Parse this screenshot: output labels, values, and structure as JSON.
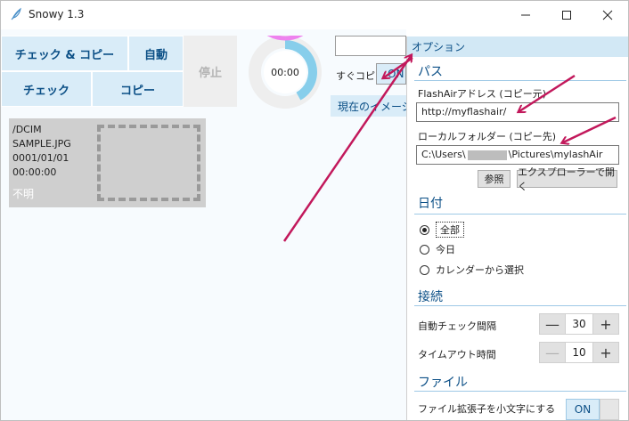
{
  "window": {
    "title": "Snowy 1.3",
    "icons": {
      "app": "feather-icon",
      "minimize": "minimize-icon",
      "maximize": "maximize-icon",
      "close": "close-icon"
    }
  },
  "toolbar": {
    "check_and_copy": "チェック & コピー",
    "auto": "自動",
    "check": "チェック",
    "copy": "コピー",
    "stop": "停止",
    "timer": "00:00",
    "timer_progress": 0.42,
    "auto_copy_label": "すぐコピー",
    "auto_copy_toggle": "ON",
    "current_image_tab": "現在のイメージ"
  },
  "file_card": {
    "path": "/DCIM",
    "filename": "SAMPLE.JPG",
    "date": "0001/01/01",
    "time": "00:00:00",
    "status": "不明"
  },
  "options": {
    "header": "オプション",
    "path_section": {
      "title": "パス",
      "flashair_label": "FlashAirアドレス (コピー元)",
      "flashair_value": "http://myflashair/",
      "local_folder_label": "ローカルフォルダー (コピー先)",
      "local_folder_prefix": "C:\\Users\\",
      "local_folder_suffix": "\\Pictures\\mylashAir",
      "browse": "参照",
      "open_explorer": "エクスプローラーで開く"
    },
    "date_section": {
      "title": "日付",
      "options": [
        "全部",
        "今日",
        "カレンダーから選択"
      ],
      "selected": "全部"
    },
    "connection_section": {
      "title": "接続",
      "auto_check_interval_label": "自動チェック間隔",
      "auto_check_interval_value": "30",
      "timeout_label": "タイムアウト時間",
      "timeout_value": "10",
      "minus": "—",
      "plus": "+"
    },
    "file_section": {
      "title": "ファイル",
      "lowercase_ext_label": "ファイル拡張子を小文字にする",
      "lowercase_ext_toggle": "ON"
    }
  },
  "colors": {
    "accent": "#0b4f86",
    "button_bg": "#d9ecf8",
    "panel_header_bg": "#d2e8f5",
    "timer_ring": "#ee82ee",
    "timer_fill": "#87ceeb",
    "annotation_arrow": "#c2185b"
  }
}
